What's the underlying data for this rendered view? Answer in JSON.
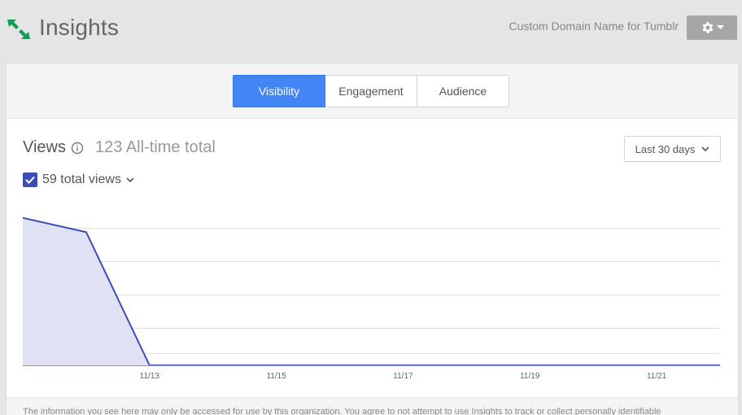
{
  "header": {
    "title": "Insights",
    "site_name": "Custom Domain Name for Tumblr",
    "logo_icon": "insights-arrows-icon",
    "settings_icon": "gear-icon",
    "brand_color": "#0f9d58"
  },
  "tabs": [
    {
      "label": "Visibility",
      "active": true
    },
    {
      "label": "Engagement",
      "active": false
    },
    {
      "label": "Audience",
      "active": false
    }
  ],
  "views": {
    "label": "Views",
    "info_icon": "info-icon",
    "all_time_total": "123 All-time total"
  },
  "date_range": {
    "selected": "Last 30 days"
  },
  "series_toggle": {
    "label": "59 total views",
    "checked": true
  },
  "chart_data": {
    "type": "area",
    "title": "",
    "xlabel": "",
    "ylabel": "",
    "y_ticks": [
      "30",
      "23",
      "16",
      "9"
    ],
    "y_tick_values": [
      30,
      23,
      16,
      9
    ],
    "ylim": [
      0,
      33
    ],
    "x_ticks": [
      "11/13",
      "11/15",
      "11/17",
      "11/19",
      "11/21"
    ],
    "grid": true,
    "series": [
      {
        "color": "#3d4db7",
        "fill": "#dfe2f4",
        "x": [
          "11/11",
          "11/12",
          "11/13",
          "11/14",
          "11/15",
          "11/16",
          "11/17",
          "11/18",
          "11/19",
          "11/20",
          "11/21",
          "11/22"
        ],
        "values": [
          31,
          28,
          0,
          0,
          0,
          0,
          0,
          0,
          0,
          0,
          0,
          0
        ]
      }
    ]
  },
  "footer": {
    "text": "The information you see here may only be accessed for use by this organization. You agree to not attempt to use Insights to track or collect personally identifiable"
  }
}
